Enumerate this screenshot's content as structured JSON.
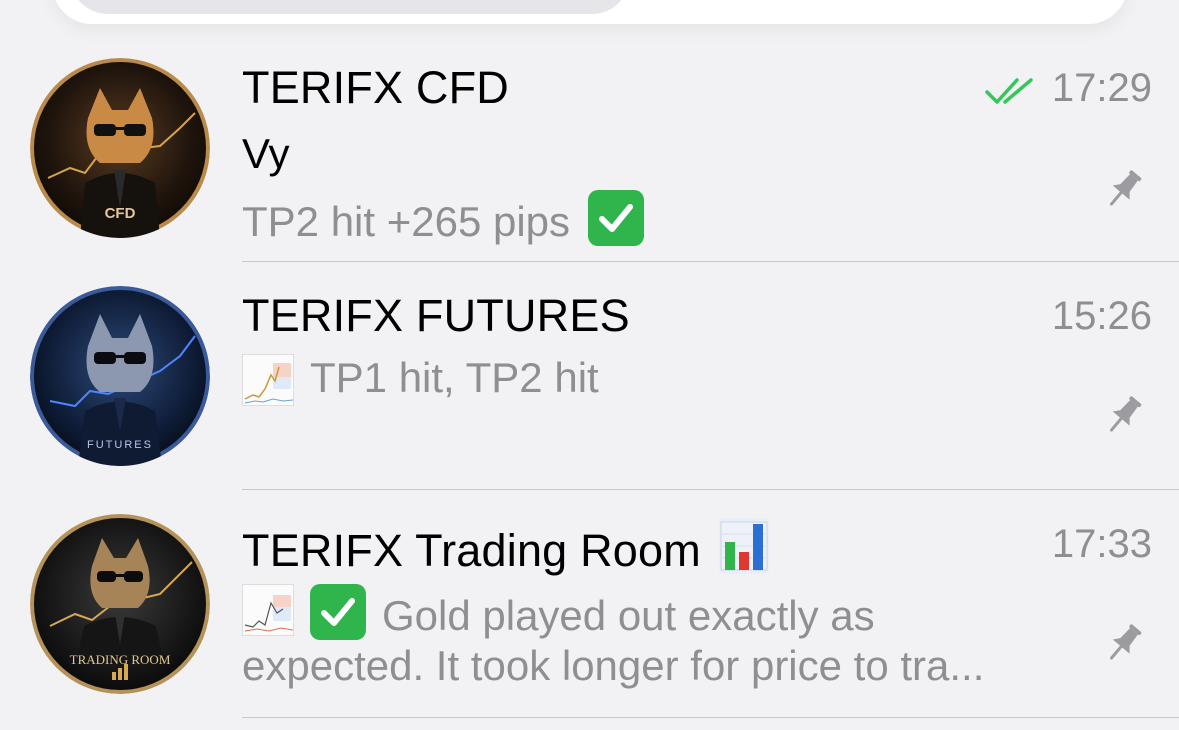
{
  "chats": [
    {
      "title": "TERIFX CFD",
      "time": "17:29",
      "sender": "Vy",
      "preview": "TP2 hit +265 pips",
      "preview_emoji": "check-mark-button-icon",
      "read_status": "double-check-icon",
      "pinned": true,
      "avatar_label": "CFD"
    },
    {
      "title": "TERIFX FUTURES",
      "time": "15:26",
      "preview": "TP1 hit, TP2 hit",
      "preview_thumbnail": "chart-thumbnail",
      "pinned": true,
      "avatar_label": "FUTURES"
    },
    {
      "title": "TERIFX Trading Room",
      "title_emoji": "bar-chart-icon",
      "time": "17:33",
      "preview_line1": "Gold played out exactly as",
      "preview_line2": "expected. It took longer for price to tra...",
      "preview_thumbnail": "chart-thumbnail",
      "preview_emoji": "check-mark-button-icon",
      "pinned": true,
      "avatar_label": "TRADING ROOM"
    }
  ],
  "colors": {
    "background": "#f2f2f4",
    "title_text": "#000000",
    "secondary_text": "#8e8e93",
    "read_check": "#34c759",
    "check_emoji": "#2fb54c",
    "pin": "#9b9ba0",
    "divider": "#c8c8cc"
  }
}
